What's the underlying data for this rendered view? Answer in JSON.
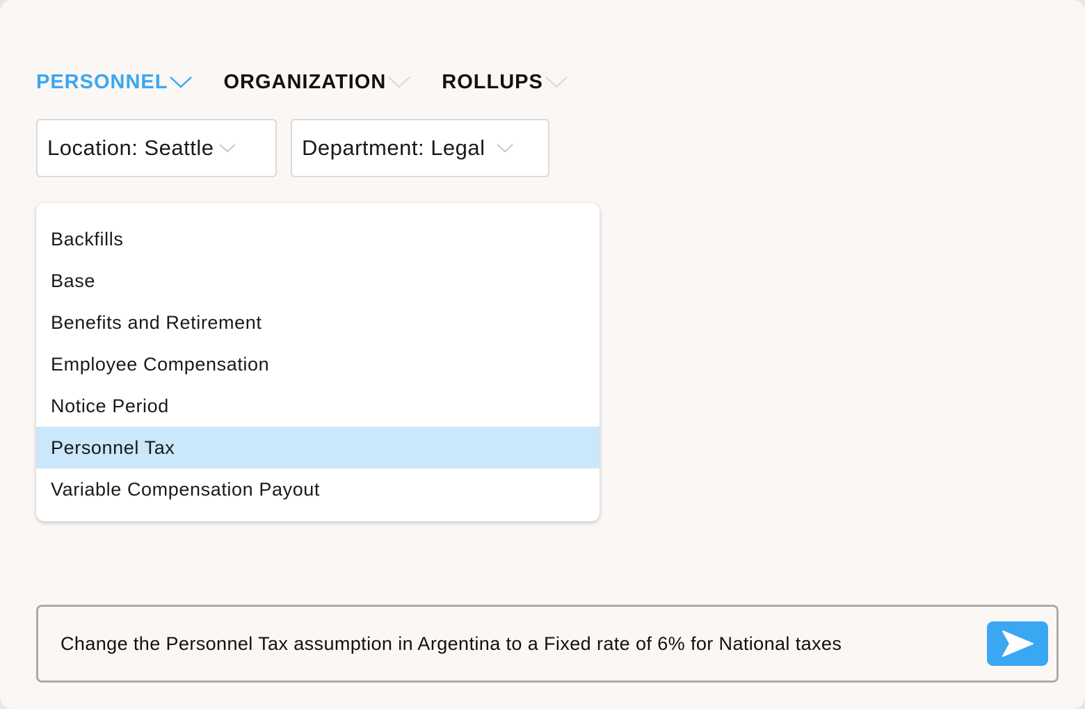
{
  "tabs": [
    {
      "label": "PERSONNEL",
      "active": true,
      "icon": "chevron-down-icon"
    },
    {
      "label": "ORGANIZATION",
      "active": false,
      "icon": "chevron-down-icon"
    },
    {
      "label": "ROLLUPS",
      "active": false,
      "icon": "chevron-down-icon"
    }
  ],
  "filters": {
    "location": {
      "label": "Location: Seattle",
      "icon": "chevron-down-icon"
    },
    "department": {
      "label": "Department: Legal",
      "icon": "chevron-down-icon"
    }
  },
  "dropdown": {
    "items": [
      {
        "label": "Backfills",
        "selected": false
      },
      {
        "label": "Base",
        "selected": false
      },
      {
        "label": "Benefits and Retirement",
        "selected": false
      },
      {
        "label": "Employee Compensation",
        "selected": false
      },
      {
        "label": "Notice Period",
        "selected": false
      },
      {
        "label": "Personnel Tax",
        "selected": true
      },
      {
        "label": "Variable Compensation Payout",
        "selected": false
      }
    ]
  },
  "command": {
    "text": "Change the Personnel Tax assumption in Argentina to a Fixed rate of 6% for National taxes",
    "send_icon": "send-icon"
  },
  "colors": {
    "accent": "#3aa7f2",
    "selected_row": "#cae7fb",
    "background": "#faf7f4"
  }
}
